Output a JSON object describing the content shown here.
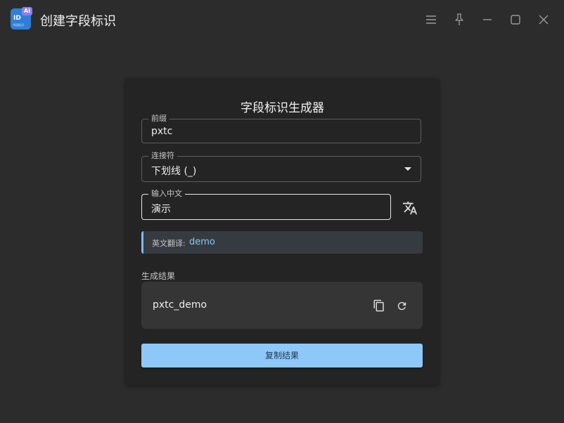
{
  "window": {
    "title": "创建字段标识",
    "icon": {
      "main": "ID",
      "sub": "字段标识",
      "badge": "AI"
    }
  },
  "form": {
    "title": "字段标识生成器",
    "prefix": {
      "label": "前缀",
      "value": "pxtc"
    },
    "connector": {
      "label": "连接符",
      "value": "下划线 (_)"
    },
    "chinese_input": {
      "label": "输入中文",
      "value": "演示"
    },
    "translation": {
      "label": "英文翻译:",
      "value": "demo"
    },
    "result": {
      "label": "生成结果",
      "value": "pxtc_demo"
    },
    "copy_button": "复制结果"
  },
  "colors": {
    "accent": "#8ec8f8",
    "translation_text": "#8ec5f5",
    "icon_blue": "#2f7fd8",
    "ai_badge": "#8e7cf0"
  },
  "icons": [
    "menu-icon",
    "pin-icon",
    "minimize-icon",
    "maximize-icon",
    "close-icon",
    "translate-icon",
    "copy-icon",
    "refresh-icon"
  ]
}
